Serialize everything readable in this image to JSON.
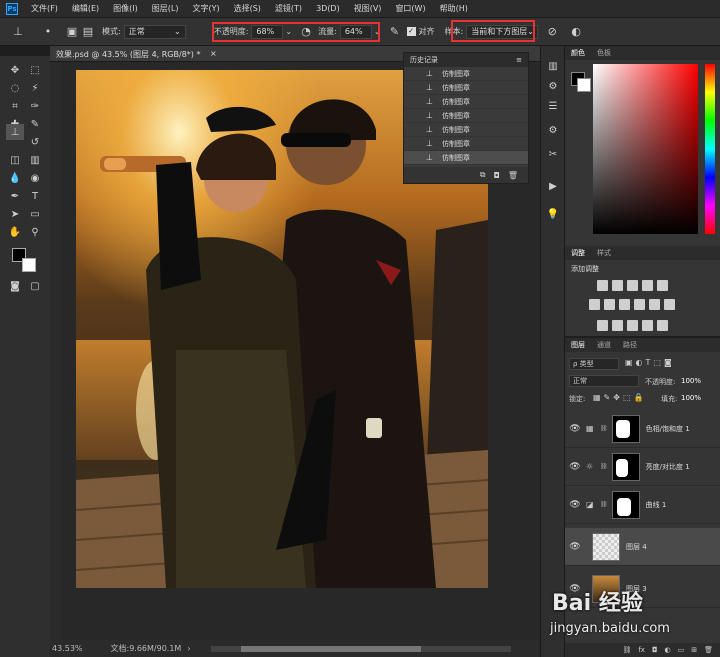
{
  "menubar": {
    "items": [
      "文件(F)",
      "编辑(E)",
      "图像(I)",
      "图层(L)",
      "文字(Y)",
      "选择(S)",
      "滤镜(T)",
      "3D(D)",
      "视图(V)",
      "窗口(W)",
      "帮助(H)"
    ]
  },
  "options": {
    "mode_label": "模式:",
    "mode_value": "正常",
    "opacity_label": "不透明度:",
    "opacity_value": "68%",
    "flow_label": "流量:",
    "flow_value": "64%",
    "align_label": "对齐",
    "sample_label": "样本:",
    "sample_value": "当前和下方图层"
  },
  "document": {
    "tab_title": "效果.psd @ 43.5% (图层 4, RGB/8*) *",
    "zoom": "43.53%",
    "doc_info": "文档:9.66M/90.1M"
  },
  "history": {
    "title": "历史记录",
    "items": [
      "仿制图章",
      "仿制图章",
      "仿制图章",
      "仿制图章",
      "仿制图章",
      "仿制图章",
      "仿制图章"
    ]
  },
  "color_panel": {
    "tabs": [
      "颜色",
      "色板"
    ]
  },
  "adjust_panel": {
    "tabs": [
      "调整",
      "样式"
    ],
    "add_label": "添加调整"
  },
  "layers_panel": {
    "tabs": [
      "图层",
      "通道",
      "路径"
    ],
    "filter_label": "ρ 类型",
    "blend_mode": "正常",
    "opacity_label": "不透明度:",
    "opacity_value": "100%",
    "lock_label": "锁定:",
    "fill_label": "填充:",
    "fill_value": "100%",
    "layers": [
      {
        "name": "色相/饱和度 1"
      },
      {
        "name": "亮度/对比度 1"
      },
      {
        "name": "曲线 1"
      },
      {
        "name": "图层 4"
      },
      {
        "name": "图层 3"
      }
    ]
  },
  "watermark": {
    "brand": "Bai 经验",
    "url": "jingyan.baidu.com"
  }
}
